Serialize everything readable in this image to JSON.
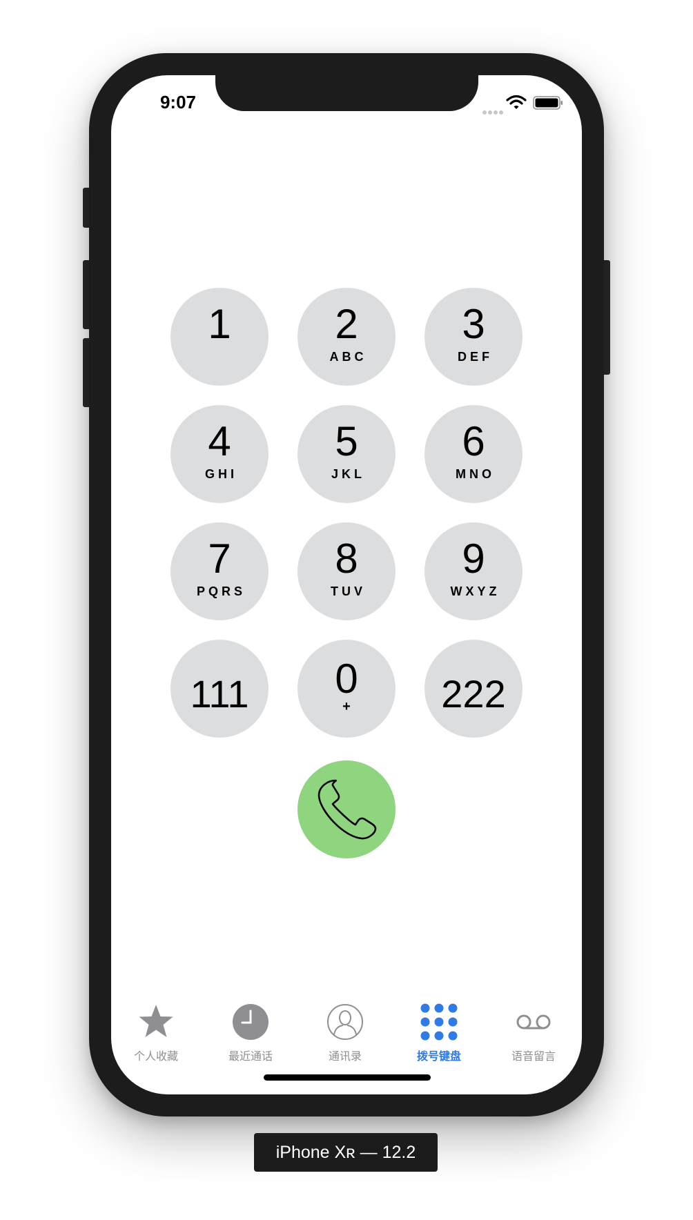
{
  "status_bar": {
    "time": "9:07"
  },
  "keypad": [
    {
      "digit": "1",
      "letters": ""
    },
    {
      "digit": "2",
      "letters": "ABC"
    },
    {
      "digit": "3",
      "letters": "DEF"
    },
    {
      "digit": "4",
      "letters": "GHI"
    },
    {
      "digit": "5",
      "letters": "JKL"
    },
    {
      "digit": "6",
      "letters": "MNO"
    },
    {
      "digit": "7",
      "letters": "PQRS"
    },
    {
      "digit": "8",
      "letters": "TUV"
    },
    {
      "digit": "9",
      "letters": "WXYZ"
    },
    {
      "digit": "111",
      "letters": ""
    },
    {
      "digit": "0",
      "letters": "+"
    },
    {
      "digit": "222",
      "letters": ""
    }
  ],
  "call_button": {
    "icon": "phone-icon",
    "color": "#8fd47f"
  },
  "tab_bar": {
    "active_color": "#2f7ae5",
    "inactive_color": "#8e8e93",
    "items": [
      {
        "label": "个人收藏",
        "icon": "star-icon"
      },
      {
        "label": "最近通话",
        "icon": "clock-icon"
      },
      {
        "label": "通讯录",
        "icon": "contact-icon"
      },
      {
        "label": "拨号键盘",
        "icon": "keypad-icon",
        "active": true
      },
      {
        "label": "语音留言",
        "icon": "voicemail-icon"
      }
    ]
  },
  "device_caption": "iPhone Xʀ — 12.2"
}
